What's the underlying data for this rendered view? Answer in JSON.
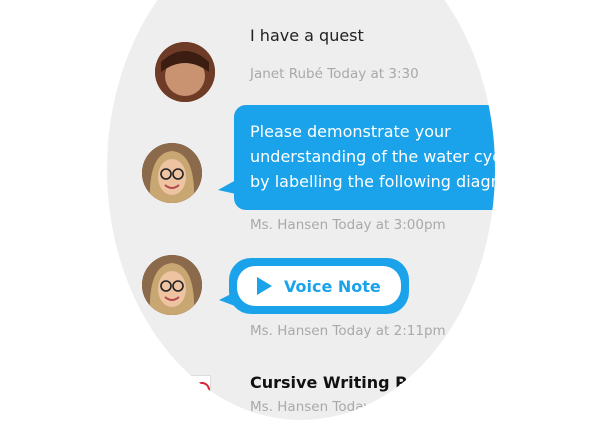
{
  "messages": {
    "top": {
      "text": "I have a quest",
      "meta": "Janet Rubé Today at 3:30"
    },
    "instruction": {
      "text": "Please demonstrate your understanding of the water cycle by labelling the following diagram.",
      "line1": "Please demonstrate your",
      "line2": "understanding of the water cycle",
      "line3": "by labelling the following diagram.",
      "meta": "Ms. Hansen Today at 3:00pm"
    },
    "voice": {
      "label": "Voice Note",
      "meta": "Ms. Hansen Today at 2:11pm"
    },
    "assignment": {
      "title": "Cursive Writing Pract",
      "meta": "Ms. Hansen Today"
    }
  },
  "colors": {
    "accent": "#1aa2ea",
    "bubble_bg": "#eeeeee",
    "meta_text": "#a9a9a9"
  },
  "icons": [
    "play-icon",
    "avatar",
    "attachment-thumbnail"
  ]
}
